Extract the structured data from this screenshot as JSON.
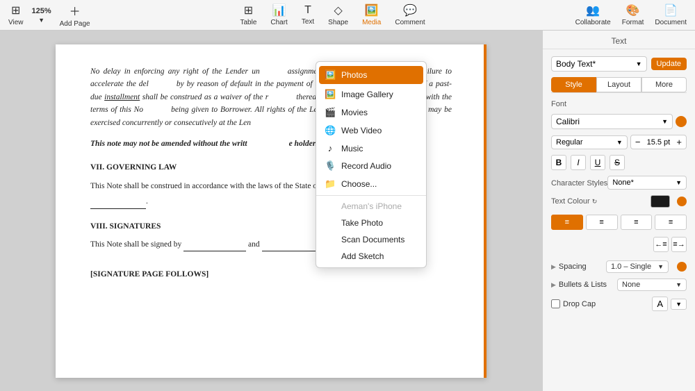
{
  "toolbar": {
    "left": {
      "view_label": "View",
      "zoom_label": "125%",
      "add_page_label": "Add Page"
    },
    "center": [
      {
        "id": "table",
        "label": "Table"
      },
      {
        "id": "chart",
        "label": "Chart"
      },
      {
        "id": "text",
        "label": "Text"
      },
      {
        "id": "shape",
        "label": "Shape"
      },
      {
        "id": "media",
        "label": "Media",
        "active": true
      },
      {
        "id": "comment",
        "label": "Comment"
      }
    ],
    "right": [
      {
        "id": "collaborate",
        "label": "Collaborate"
      },
      {
        "id": "format",
        "label": "Format"
      },
      {
        "id": "document",
        "label": "Document"
      }
    ]
  },
  "dropdown": {
    "items": [
      {
        "id": "photos",
        "label": "Photos",
        "active": true,
        "icon": "🖼️"
      },
      {
        "id": "image-gallery",
        "label": "Image Gallery",
        "icon": "🖼️"
      },
      {
        "id": "movies",
        "label": "Movies",
        "icon": "🎬"
      },
      {
        "id": "web-video",
        "label": "Web Video",
        "icon": "🌐"
      },
      {
        "id": "music",
        "label": "Music",
        "icon": "♪"
      },
      {
        "id": "record-audio",
        "label": "Record Audio",
        "icon": "🎙️"
      },
      {
        "id": "choose",
        "label": "Choose...",
        "icon": "📁"
      },
      {
        "id": "aemans-iphone",
        "label": "Aeman's iPhone",
        "disabled": true,
        "icon": ""
      },
      {
        "id": "take-photo",
        "label": "Take Photo",
        "icon": ""
      },
      {
        "id": "scan-documents",
        "label": "Scan Documents",
        "icon": ""
      },
      {
        "id": "add-sketch",
        "label": "Add Sketch",
        "icon": ""
      }
    ]
  },
  "document": {
    "paragraphs": [
      "No delay in enforcing any right of the Lender under this Note, or the exercise of any right by the Lender, or acceptance of any assignment by Lender of this Note, or failure to accelerate the debt evidenced hereby by reason of default in the payment of a monthly installment or acceptance of a past-due installment shall be construed as a waiver of the right of the Lender to thereafter insist upon strict compliance with the terms of this Note, notice being given to Borrower. All rights of the Lender under this Note are cumulative and may be exercised concurrently or consecutively at the Lender's option."
    ],
    "bold_italic_line": "This note may not be amended without the written consent of the holder.",
    "section_7": {
      "title": "VII. GOVERNING LAW",
      "text": "This Note shall be construed in accordance with the laws of the State of ___________."
    },
    "section_8": {
      "title": "VIII. SIGNATURES",
      "text": "This Note shall be signed by ___________ and ___________.",
      "signature_block": "[SIGNATURE PAGE FOLLOWS]"
    }
  },
  "right_panel": {
    "title": "Text",
    "style_name": "Body Text*",
    "update_label": "Update",
    "tabs": [
      "Style",
      "Layout",
      "More"
    ],
    "active_tab": "Style",
    "font_section": {
      "label": "Font",
      "font_name": "Calibri",
      "font_style": "Regular",
      "font_size": "15.5 pt"
    },
    "format_buttons": [
      "B",
      "I",
      "U",
      "S"
    ],
    "character_styles": {
      "label": "Character Styles",
      "value": "None*"
    },
    "text_color": {
      "label": "Text Colour"
    },
    "spacing": {
      "label": "Spacing",
      "value": "1.0 – Single"
    },
    "bullets_lists": {
      "label": "Bullets & Lists",
      "value": "None"
    },
    "drop_cap": {
      "label": "Drop Cap"
    }
  }
}
